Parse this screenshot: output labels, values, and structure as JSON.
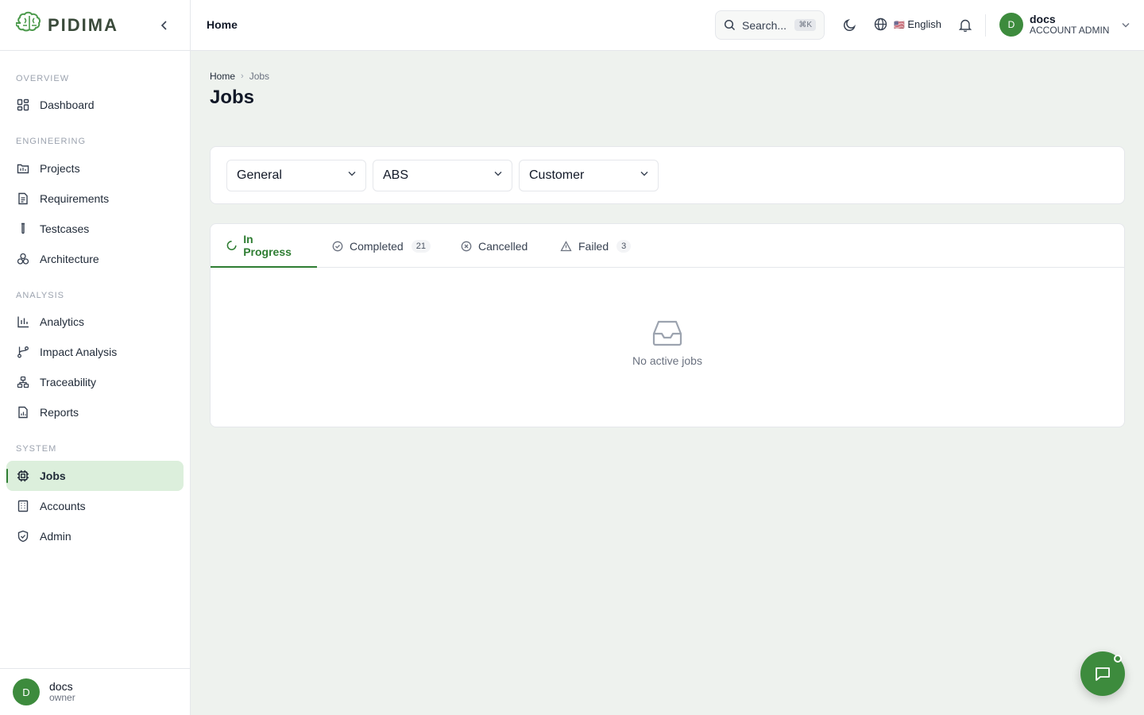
{
  "brand": {
    "logo_text": "PIDIMA",
    "logo_icon": "brain-icon"
  },
  "header": {
    "title": "Home",
    "search_placeholder": "Search...",
    "search_shortcut": "⌘K",
    "language_flag": "🇺🇸",
    "language": "English",
    "user": {
      "initial": "D",
      "name": "docs",
      "role": "ACCOUNT ADMIN"
    }
  },
  "sidebar": {
    "sections": {
      "overview": "OVERVIEW",
      "engineering": "ENGINEERING",
      "analysis": "ANALYSIS",
      "system": "SYSTEM"
    },
    "items": [
      {
        "label": "Dashboard",
        "icon": "grid-icon"
      },
      {
        "label": "Projects",
        "icon": "folder-icon"
      },
      {
        "label": "Requirements",
        "icon": "document-icon"
      },
      {
        "label": "Testcases",
        "icon": "test-tube-icon"
      },
      {
        "label": "Architecture",
        "icon": "components-icon"
      },
      {
        "label": "Analytics",
        "icon": "bar-chart-icon"
      },
      {
        "label": "Impact Analysis",
        "icon": "git-branch-icon"
      },
      {
        "label": "Traceability",
        "icon": "network-icon"
      },
      {
        "label": "Reports",
        "icon": "report-icon"
      },
      {
        "label": "Jobs",
        "icon": "cpu-icon",
        "active": true
      },
      {
        "label": "Accounts",
        "icon": "building-icon"
      },
      {
        "label": "Admin",
        "icon": "shield-icon"
      }
    ],
    "footer": {
      "initial": "D",
      "name": "docs",
      "role": "owner"
    }
  },
  "breadcrumb": {
    "home": "Home",
    "separator": "›",
    "current": "Jobs"
  },
  "page": {
    "title": "Jobs"
  },
  "filters": [
    {
      "value": "General"
    },
    {
      "value": "ABS"
    },
    {
      "value": "Customer"
    }
  ],
  "tabs": [
    {
      "label": "In Progress",
      "icon": "spinner-icon",
      "active": true
    },
    {
      "label": "Completed",
      "icon": "check-circle-icon",
      "count": "21"
    },
    {
      "label": "Cancelled",
      "icon": "x-circle-icon"
    },
    {
      "label": "Failed",
      "icon": "warning-icon",
      "count": "3"
    }
  ],
  "empty_state": {
    "icon": "inbox-icon",
    "text": "No active jobs"
  },
  "colors": {
    "accent": "#2e7d32",
    "avatar": "#3d8b3d",
    "active_bg": "#dcefdc",
    "page_bg": "#eef2ee"
  }
}
